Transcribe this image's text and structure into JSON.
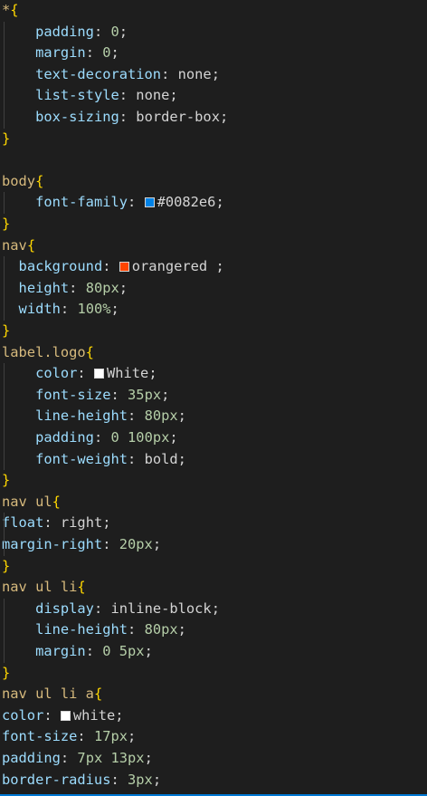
{
  "editor": {
    "theme": "dark",
    "lines": [
      {
        "indent": 0,
        "selector": "*",
        "brace": "{"
      },
      {
        "indent": 2,
        "property": "padding",
        "value": "0",
        "valueType": "num"
      },
      {
        "indent": 2,
        "property": "margin",
        "value": "0",
        "valueType": "num"
      },
      {
        "indent": 2,
        "property": "text-decoration",
        "value": "none",
        "valueType": "kw"
      },
      {
        "indent": 2,
        "property": "list-style",
        "value": "none",
        "valueType": "kw"
      },
      {
        "indent": 2,
        "property": "box-sizing",
        "value": "border-box",
        "valueType": "kw"
      },
      {
        "indent": 0,
        "brace": "}"
      },
      {
        "indent": 0,
        "blank": true
      },
      {
        "indent": 0,
        "selector": "body",
        "brace": "{"
      },
      {
        "indent": 2,
        "property": "font-family",
        "value": "#0082e6",
        "valueType": "kw",
        "swatch": "#0082e6"
      },
      {
        "indent": 0,
        "brace": "}"
      },
      {
        "indent": 0,
        "selector": "nav",
        "brace": "{"
      },
      {
        "indent": 1,
        "property": "background",
        "value": "orangered ",
        "valueType": "kw",
        "swatch": "#ff4500"
      },
      {
        "indent": 1,
        "property": "height",
        "value": "80px",
        "valueType": "num"
      },
      {
        "indent": 1,
        "property": "width",
        "value": "100%",
        "valueType": "num"
      },
      {
        "indent": 0,
        "brace": "}"
      },
      {
        "indent": 0,
        "selector": "label.logo",
        "brace": "{"
      },
      {
        "indent": 2,
        "property": "color",
        "value": "White",
        "valueType": "kw",
        "swatch": "#ffffff"
      },
      {
        "indent": 2,
        "property": "font-size",
        "value": "35px",
        "valueType": "num"
      },
      {
        "indent": 2,
        "property": "line-height",
        "value": "80px",
        "valueType": "num"
      },
      {
        "indent": 2,
        "property": "padding",
        "value": "0 100px",
        "valueType": "num"
      },
      {
        "indent": 2,
        "property": "font-weight",
        "value": "bold",
        "valueType": "kw"
      },
      {
        "indent": 0,
        "brace": "}"
      },
      {
        "indent": 0,
        "selector": "nav ul",
        "brace": "{"
      },
      {
        "indent": 0,
        "property": "float",
        "value": "right",
        "valueType": "kw"
      },
      {
        "indent": 0,
        "property": "margin-right",
        "value": "20px",
        "valueType": "num"
      },
      {
        "indent": 0,
        "brace": "}"
      },
      {
        "indent": 0,
        "selector": "nav ul li",
        "brace": "{"
      },
      {
        "indent": 2,
        "property": "display",
        "value": "inline-block",
        "valueType": "kw"
      },
      {
        "indent": 2,
        "property": "line-height",
        "value": "80px",
        "valueType": "num"
      },
      {
        "indent": 2,
        "property": "margin",
        "value": "0 5px",
        "valueType": "num"
      },
      {
        "indent": 0,
        "brace": "}"
      },
      {
        "indent": 0,
        "selector": "nav ul li a",
        "brace": "{"
      },
      {
        "indent": 0,
        "property": "color",
        "value": "white",
        "valueType": "kw",
        "swatch": "#ffffff"
      },
      {
        "indent": 0,
        "property": "font-size",
        "value": "17px",
        "valueType": "num"
      },
      {
        "indent": 0,
        "property": "padding",
        "value": "7px 13px",
        "valueType": "num"
      },
      {
        "indent": 0,
        "property": "border-radius",
        "value": "3px",
        "valueType": "num"
      }
    ]
  }
}
